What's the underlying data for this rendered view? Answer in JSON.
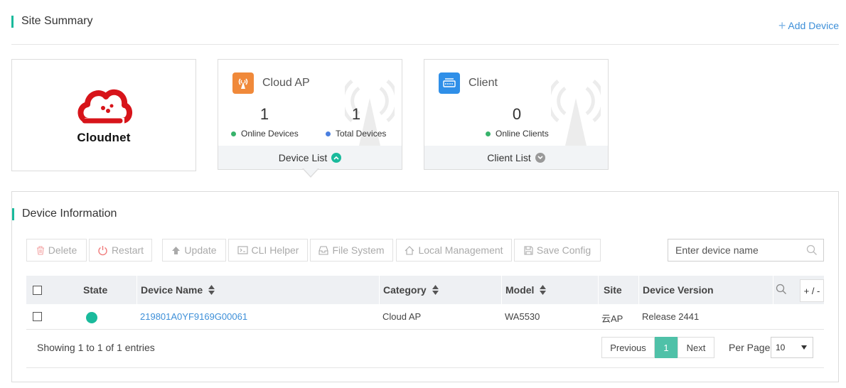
{
  "site_summary": {
    "title": "Site Summary",
    "add_device_label": "Add Device"
  },
  "logo": {
    "brand_name": "Cloudnet",
    "brand_color": "#d7141a"
  },
  "cloud_ap_card": {
    "title": "Cloud AP",
    "online_devices_value": "1",
    "online_devices_label": "Online Devices",
    "total_devices_value": "1",
    "total_devices_label": "Total Devices",
    "footer_label": "Device List",
    "icon": "wifi-tower-icon"
  },
  "client_card": {
    "title": "Client",
    "online_clients_value": "0",
    "online_clients_label": "Online Clients",
    "footer_label": "Client List",
    "icon": "client-device-icon"
  },
  "device_info": {
    "title": "Device Information",
    "toolbar": {
      "delete": "Delete",
      "restart": "Restart",
      "update": "Update",
      "cli_helper": "CLI Helper",
      "file_system": "File System",
      "local_management": "Local Management",
      "save_config": "Save Config"
    },
    "search_placeholder": "Enter device name",
    "columns": {
      "state": "State",
      "device_name": "Device Name",
      "category": "Category",
      "model": "Model",
      "site": "Site",
      "device_version": "Device Version",
      "toggle": "+ / -"
    },
    "rows": [
      {
        "device_name": "219801A0YF9169G00061",
        "category": "Cloud AP",
        "model": "WA5530",
        "site": "云AP",
        "device_version": "Release 2441",
        "state": "online"
      }
    ],
    "footer": {
      "showing": "Showing 1 to 1 of 1 entries",
      "previous": "Previous",
      "current_page": "1",
      "next": "Next",
      "per_page_label": "Per Page",
      "per_page_value": "10"
    }
  },
  "colors": {
    "accent": "#1aba9c",
    "link": "#3d8fd8",
    "ap_icon_bg": "#f0893a",
    "client_icon_bg": "#2f8fe8"
  }
}
